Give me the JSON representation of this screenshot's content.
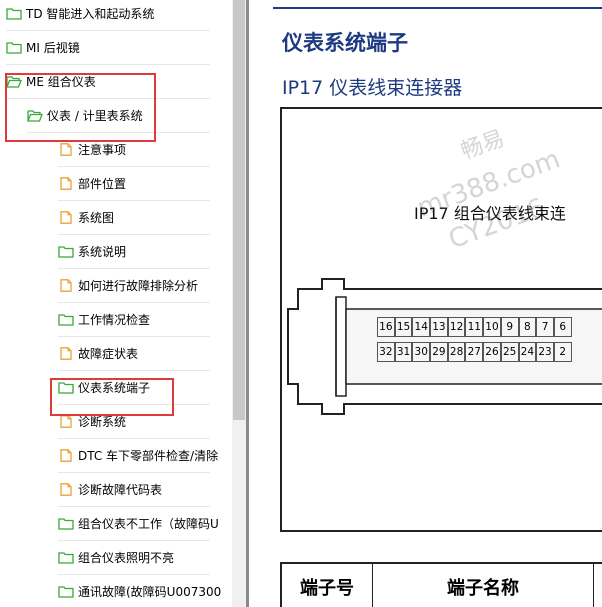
{
  "tree": {
    "items": [
      {
        "label": "TD 智能进入和起动系统",
        "icon": "folder-icon",
        "level": 0
      },
      {
        "label": "MI 后视镜",
        "icon": "folder-icon",
        "level": 0
      },
      {
        "label": "ME 组合仪表",
        "icon": "folder-open-icon",
        "level": 0
      },
      {
        "label": "仪表 / 计里表系统",
        "icon": "folder-open-icon",
        "level": 1
      },
      {
        "label": "注意事项",
        "icon": "document-icon",
        "level": 2
      },
      {
        "label": "部件位置",
        "icon": "document-icon",
        "level": 2
      },
      {
        "label": "系统图",
        "icon": "document-icon",
        "level": 2
      },
      {
        "label": "系统说明",
        "icon": "folder-icon",
        "level": 2
      },
      {
        "label": "如何进行故障排除分析",
        "icon": "document-icon",
        "level": 2
      },
      {
        "label": "工作情况检查",
        "icon": "folder-icon",
        "level": 2
      },
      {
        "label": "故障症状表",
        "icon": "document-icon",
        "level": 2
      },
      {
        "label": "仪表系统端子",
        "icon": "folder-icon",
        "level": 2
      },
      {
        "label": "诊断系统",
        "icon": "document-icon",
        "level": 2
      },
      {
        "label": "DTC 车下零部件检查/清除",
        "icon": "document-icon",
        "level": 2
      },
      {
        "label": "诊断故障代码表",
        "icon": "document-icon",
        "level": 2
      },
      {
        "label": "组合仪表不工作（故障码U",
        "icon": "folder-icon",
        "level": 2
      },
      {
        "label": "组合仪表照明不亮",
        "icon": "folder-icon",
        "level": 2
      },
      {
        "label": "通讯故障(故障码U007300",
        "icon": "folder-icon",
        "level": 2
      }
    ]
  },
  "colors": {
    "title_blue": "#1e3a82",
    "highlight_red": "#e03a3a",
    "folder_green": "#3aa83a",
    "doc_orange": "#e8a33a"
  },
  "doc": {
    "title": "仪表系统端子",
    "subtitle": "IP17  仪表线束连接器",
    "figure_caption": "IP17 组合仪表线束连",
    "watermark_lines": [
      "畅易",
      "mr388.com",
      "CY2016"
    ],
    "connector_pins_top": [
      "16",
      "15",
      "14",
      "13",
      "12",
      "11",
      "10",
      "9",
      "8",
      "7",
      "6"
    ],
    "connector_pins_bottom": [
      "32",
      "31",
      "30",
      "29",
      "28",
      "27",
      "26",
      "25",
      "24",
      "23",
      "2"
    ],
    "table_headers": [
      "端子号",
      "端子名称"
    ]
  }
}
